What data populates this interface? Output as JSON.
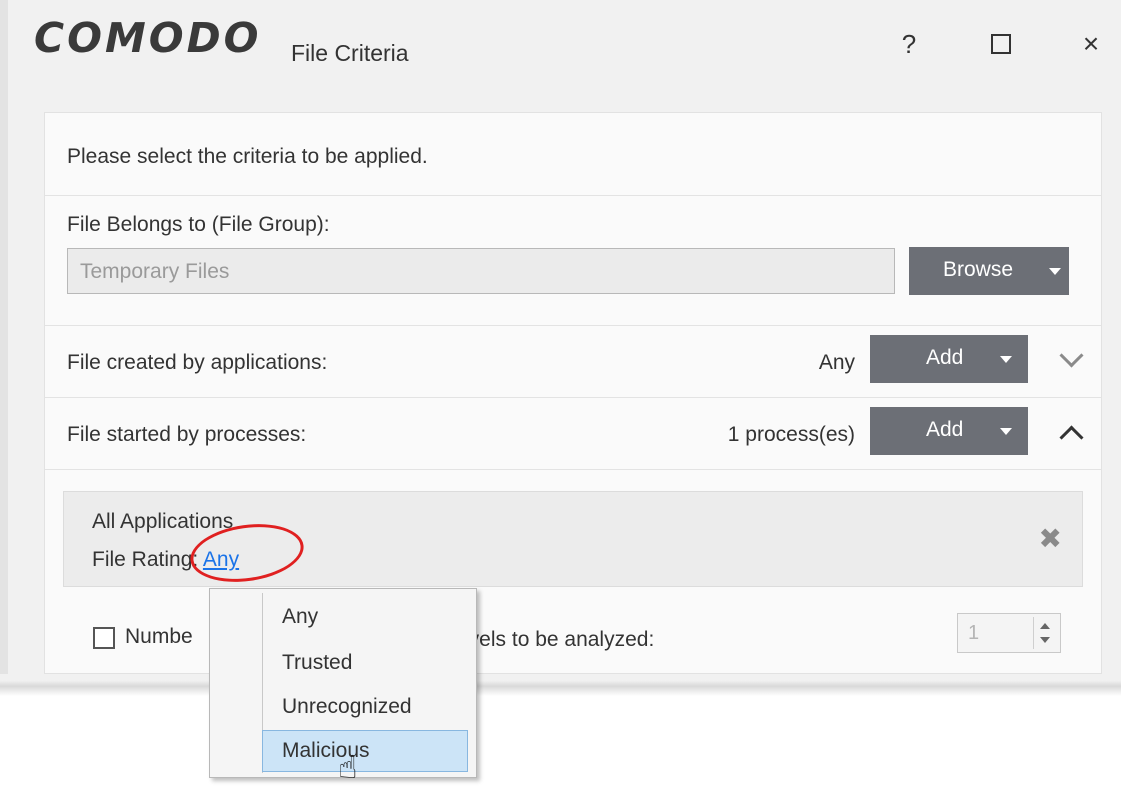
{
  "window": {
    "logo": "COMODO",
    "title": "File Criteria",
    "help": "?",
    "close": "×"
  },
  "panel": {
    "intro": "Please select the criteria to be applied.",
    "file_group": {
      "label": "File Belongs to (File Group):",
      "value": "Temporary Files",
      "browse_label": "Browse"
    },
    "created_by": {
      "label": "File created by applications:",
      "value": "Any",
      "add_label": "Add"
    },
    "started_by": {
      "label": "File started by processes:",
      "value": "1 process(es)",
      "add_label": "Add"
    },
    "process_item": {
      "title": "All Applications",
      "rating_label": "File Rating:",
      "rating_value": "Any"
    },
    "levels": {
      "label_start": "Numbe",
      "label_end": "evels to be analyzed:",
      "value": "1"
    }
  },
  "rating_menu": {
    "items": [
      "Any",
      "Trusted",
      "Unrecognized",
      "Malicious"
    ],
    "highlighted": "Malicious"
  },
  "colors": {
    "button": "#6c6f76",
    "link": "#1a73e8",
    "highlight": "#cce4f7",
    "annotation": "#e02020"
  }
}
